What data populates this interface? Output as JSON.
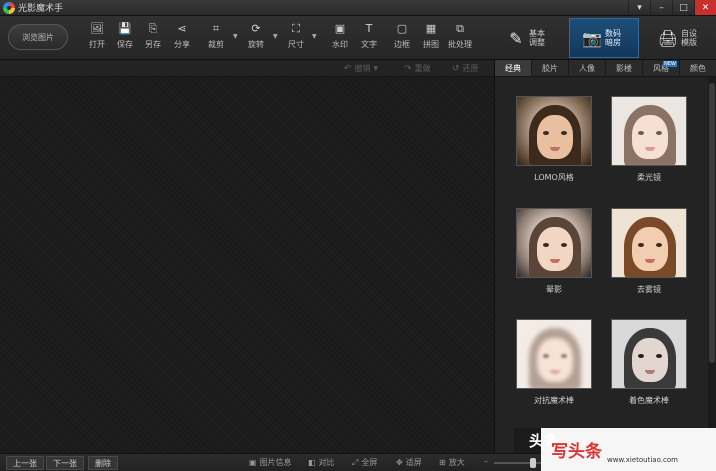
{
  "titlebar": {
    "app_title": "光影魔术手",
    "buttons": [
      "▾",
      "–",
      "□",
      "✕"
    ]
  },
  "toolbar": {
    "browse_label": "浏览图片",
    "tools": [
      {
        "label": "打开",
        "icon": "open-icon",
        "glyph": "🖼"
      },
      {
        "label": "保存",
        "icon": "save-icon",
        "glyph": "💾"
      },
      {
        "label": "另存",
        "icon": "save-as-icon",
        "glyph": "⎘"
      },
      {
        "label": "分享",
        "icon": "share-icon",
        "glyph": "⋖"
      },
      {
        "label": "裁剪",
        "icon": "crop-icon",
        "glyph": "⌗"
      },
      {
        "label": "旋转",
        "icon": "rotate-icon",
        "glyph": "⟳"
      },
      {
        "label": "尺寸",
        "icon": "resize-icon",
        "glyph": "⛶"
      },
      {
        "label": "水印",
        "icon": "watermark-icon",
        "glyph": "▣"
      },
      {
        "label": "文字",
        "icon": "text-icon",
        "glyph": "T"
      },
      {
        "label": "边框",
        "icon": "frame-icon",
        "glyph": "▢"
      },
      {
        "label": "拼图",
        "icon": "collage-icon",
        "glyph": "▦"
      },
      {
        "label": "批处理",
        "icon": "batch-icon",
        "glyph": "⧉"
      }
    ],
    "modes": [
      {
        "label": "基本调整",
        "icon": "basic-adjust-icon",
        "glyph": "✎"
      },
      {
        "label": "数码暗房",
        "icon": "camera-icon",
        "glyph": "📷"
      },
      {
        "label": "自设模版",
        "icon": "printer-icon",
        "glyph": "🖨"
      }
    ]
  },
  "subbar": {
    "undo": "撤销",
    "redo": "重做",
    "restore": "还原"
  },
  "panel": {
    "tabs": [
      "经典",
      "胶片",
      "人像",
      "影楼",
      "风格",
      "颜色"
    ],
    "new_badge": "NEW",
    "effects": [
      {
        "label": "LOMO风格"
      },
      {
        "label": "柔光镜"
      },
      {
        "label": "晕影"
      },
      {
        "label": "去雾镜"
      },
      {
        "label": "对抗魔术棒"
      },
      {
        "label": "着色魔术棒"
      }
    ]
  },
  "bottombar": {
    "prev": "上一张",
    "next": "下一张",
    "delete": "删除",
    "info": "图片信息",
    "compare": "对比",
    "fullscreen": "全屏",
    "fit": "适屏",
    "zoom": "放大"
  },
  "watermark": {
    "badge": "头条",
    "title": "写头条",
    "url": "www.xietoutiao.com"
  }
}
